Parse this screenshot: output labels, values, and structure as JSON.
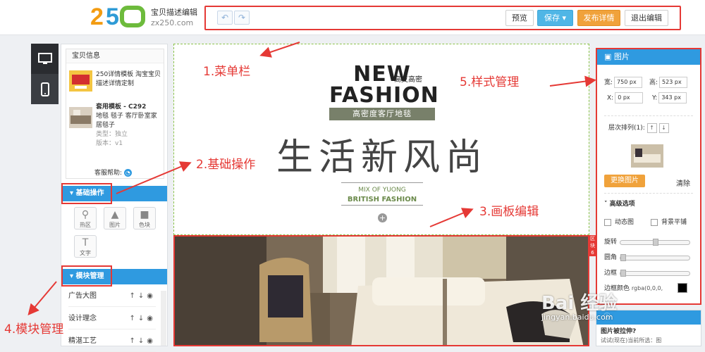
{
  "app": {
    "brand": "宝贝描述编辑",
    "domain": "zx250.com"
  },
  "toolbar": {
    "undo_icon": "undo-icon",
    "redo_icon": "redo-icon",
    "preview": "预览",
    "save": "保存",
    "publish": "发布详情",
    "exit": "退出编辑"
  },
  "left_rail": [
    {
      "icon": "desktop-icon"
    },
    {
      "icon": "mobile-icon"
    }
  ],
  "item_info": {
    "title": "宝贝信息",
    "product1": "250详情模板 淘宝宝贝描述详情定制",
    "product2_title": "套用模板 - C292",
    "product2_desc": "地毯 毯子 客厅卧室家居毯子",
    "type_label": "类型：独立",
    "version_label": "版本：v1",
    "help": "客服帮助:"
  },
  "basic_ops": {
    "title": "基础操作",
    "tools": [
      "热区",
      "图片",
      "色块",
      "文字"
    ]
  },
  "module_mgmt": {
    "title": "模块管理",
    "items": [
      "广告大图",
      "设计理念",
      "精湛工艺"
    ]
  },
  "canvas": {
    "new": "NEW",
    "fashion": "FASHION",
    "small": "高支高密",
    "band": "高密度客厅地毯",
    "slogan": "生活新风尚",
    "mix": "MIX OF YUONG",
    "british": "BRITISH FASHION",
    "side_tag": "区块6"
  },
  "style_panel": {
    "title": "图片",
    "w_label": "宽:",
    "w_val": "750 px",
    "h_label": "高:",
    "h_val": "523 px",
    "x_label": "X:",
    "x_val": "0 px",
    "y_label": "Y:",
    "y_val": "343 px",
    "order": "层次排列(1):",
    "change": "更换图片",
    "clear": "清除",
    "advanced": "高级选项",
    "anim": "动态图",
    "bg_tile": "背景平铺",
    "rotate": "旋转",
    "radius": "圆角",
    "border": "边框",
    "border_color": "边框颜色",
    "rgba": "rgba(0,0,0,"
  },
  "tip": {
    "title": "图片被拉伸?",
    "text": "试试(现在)当前所选：图"
  },
  "annotations": {
    "a1": "1.菜单栏",
    "a2": "2.基础操作",
    "a3": "3.画板编辑",
    "a4": "4.模块管理",
    "a5": "5.样式管理"
  },
  "watermark": {
    "main": "Bai 经验",
    "url": "jingyan.baidu.com"
  },
  "colors": {
    "accent_blue": "#2f9ae0",
    "annotation_red": "#e53935",
    "publish_orange": "#f0a23b",
    "save_blue": "#4fb6e6"
  }
}
